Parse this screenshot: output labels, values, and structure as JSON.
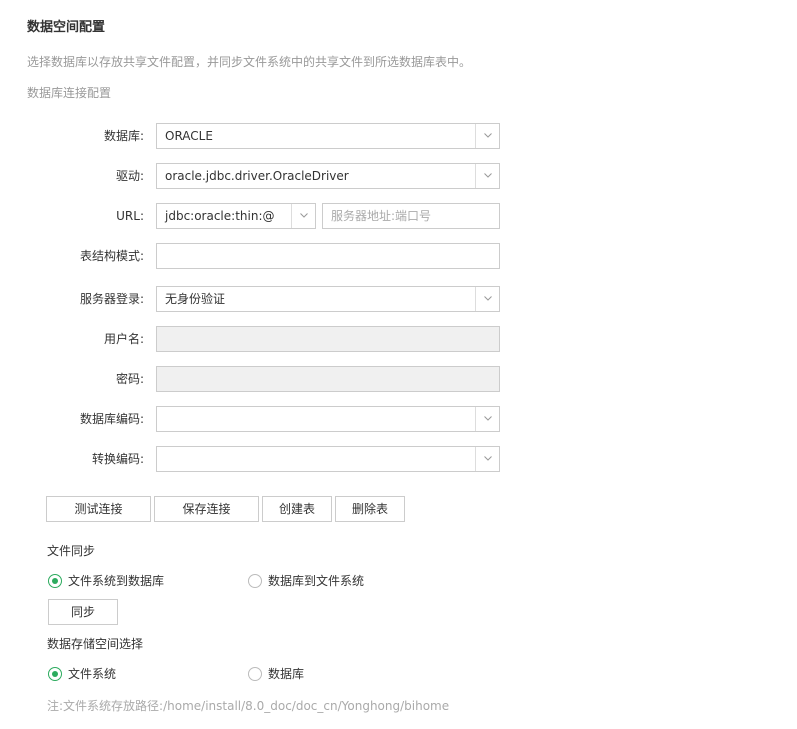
{
  "page": {
    "title": "数据空间配置",
    "description": "选择数据库以存放共享文件配置，并同步文件系统中的共享文件到所选数据库表中。",
    "section_label": "数据库连接配置"
  },
  "form": {
    "database": {
      "label": "数据库:",
      "value": "ORACLE"
    },
    "driver": {
      "label": "驱动:",
      "value": "oracle.jdbc.driver.OracleDriver"
    },
    "url": {
      "label": "URL:",
      "prefix": "jdbc:oracle:thin:@",
      "placeholder": "服务器地址:端口号"
    },
    "schema": {
      "label": "表结构模式:",
      "value": ""
    },
    "server_login": {
      "label": "服务器登录:",
      "value": "无身份验证"
    },
    "username": {
      "label": "用户名:",
      "value": ""
    },
    "password": {
      "label": "密码:",
      "value": ""
    },
    "db_encoding": {
      "label": "数据库编码:",
      "value": ""
    },
    "convert_encoding": {
      "label": "转换编码:",
      "value": ""
    }
  },
  "buttons": {
    "test": "测试连接",
    "save": "保存连接",
    "create": "创建表",
    "delete": "删除表"
  },
  "sync": {
    "title": "文件同步",
    "option_fs_to_db": "文件系统到数据库",
    "option_db_to_fs": "数据库到文件系统",
    "selected": "fs_to_db",
    "button": "同步"
  },
  "storage": {
    "title": "数据存储空间选择",
    "option_fs": "文件系统",
    "option_db": "数据库",
    "selected": "fs",
    "note": "注:文件系统存放路径:/home/install/8.0_doc/doc_cn/Yonghong/bihome"
  },
  "colors": {
    "accent": "#2cab5e",
    "border": "#cccccc",
    "disabled_bg": "#f0f0f0"
  }
}
